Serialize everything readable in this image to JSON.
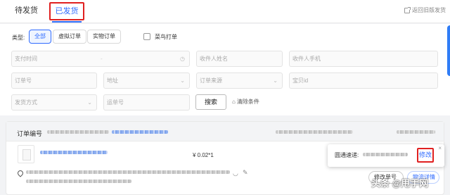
{
  "tabs": [
    {
      "label": "待发货"
    },
    {
      "label": "已发货",
      "active": true
    }
  ],
  "back_link": "返回旧版发货",
  "filters": {
    "type_label": "类型:",
    "type_chips": [
      "全部",
      "虚拟订单",
      "实物订单"
    ],
    "active_chip": "全部",
    "cainiao_label": "菜鸟打单",
    "cainiao_checked": false,
    "pay_time_placeholder": "支付时间",
    "pay_time_separator": "-",
    "receiver_name_placeholder": "收件人姓名",
    "receiver_phone_placeholder": "收件人手机",
    "order_no_placeholder": "订单号",
    "address_placeholder": "地址",
    "order_source_placeholder": "订单来源",
    "item_id_placeholder": "宝贝id",
    "ship_method_placeholder": "发货方式",
    "waybill_placeholder": "运单号",
    "search_label": "搜索",
    "clear_label": "清除条件"
  },
  "order": {
    "order_no_label": "订单编号",
    "price": "¥ 0.02*1",
    "buttons": [
      "修改单号",
      "物流详情"
    ]
  },
  "popup": {
    "carrier_label": "圆通速递:",
    "edit_label": "修改",
    "close_glyph": "×"
  },
  "watermark": "头条 @甩手网",
  "colors": {
    "accent": "#2f6bff",
    "highlight": "#e02020"
  }
}
